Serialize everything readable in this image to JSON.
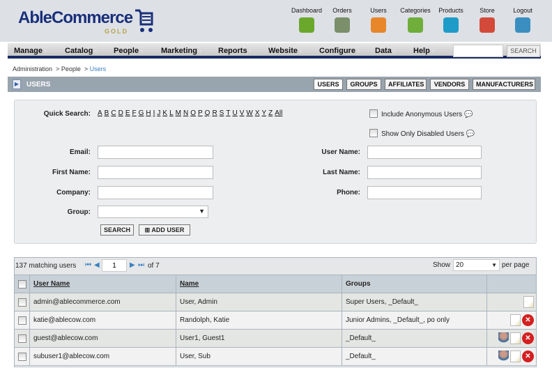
{
  "brand": {
    "name": "AbleCommerce",
    "edition": "GOLD"
  },
  "top_nav": [
    {
      "label": "Dashboard",
      "icon": "dashboard-icon",
      "color": "#6aa82c"
    },
    {
      "label": "Orders",
      "icon": "orders-icon",
      "color": "#7a8f6a"
    },
    {
      "label": "Users",
      "icon": "users-icon",
      "color": "#e8862a"
    },
    {
      "label": "Categories",
      "icon": "categories-icon",
      "color": "#6fae3a"
    },
    {
      "label": "Products",
      "icon": "products-icon",
      "color": "#1f9bc8"
    },
    {
      "label": "Store",
      "icon": "store-icon",
      "color": "#d44a3a"
    },
    {
      "label": "Logout",
      "icon": "logout-icon",
      "color": "#3a8fc0"
    }
  ],
  "menu": [
    "Manage",
    "Catalog",
    "People",
    "Marketing",
    "Reports",
    "Website",
    "Configure",
    "Data",
    "Help"
  ],
  "menu_search": {
    "value": "",
    "button": "SEARCH"
  },
  "breadcrumb": [
    "Administration",
    ">",
    "People",
    ">",
    "Users"
  ],
  "page_title": "USERS",
  "tabs": [
    "USERS",
    "GROUPS",
    "AFFILIATES",
    "VENDORS",
    "MANUFACTURERS"
  ],
  "search": {
    "quick_search_label": "Quick Search:",
    "letters": [
      "A",
      "B",
      "C",
      "D",
      "E",
      "F",
      "G",
      "H",
      "I",
      "J",
      "K",
      "L",
      "M",
      "N",
      "O",
      "P",
      "Q",
      "R",
      "S",
      "T",
      "U",
      "V",
      "W",
      "X",
      "Y",
      "Z",
      "All"
    ],
    "include_anonymous": "Include Anonymous Users",
    "only_disabled": "Show Only Disabled Users",
    "email": "Email:",
    "first_name": "First Name:",
    "company": "Company:",
    "group": "Group:",
    "user_name": "User Name:",
    "last_name": "Last Name:",
    "phone": "Phone:",
    "search_button": "SEARCH",
    "add_user_button": "ADD USER"
  },
  "results": {
    "count": "137 matching users",
    "page": "1",
    "of": "of 7",
    "show": "Show",
    "per_page_value": "20",
    "per_page": "per page",
    "columns": [
      "User Name",
      "Name",
      "Groups"
    ],
    "rows": [
      {
        "user": "admin@ablecommerce.com",
        "name": "User, Admin",
        "groups": "Super Users, _Default_",
        "login": false,
        "delete": false
      },
      {
        "user": "katie@ablecow.com",
        "name": "Randolph, Katie",
        "groups": "Junior Admins, _Default_, po only",
        "login": false,
        "delete": true
      },
      {
        "user": "guest@ablecow.com",
        "name": "User1, Guest1",
        "groups": "_Default_",
        "login": true,
        "delete": true
      },
      {
        "user": "subuser1@ablecow.com",
        "name": "User, Sub",
        "groups": "_Default_",
        "login": true,
        "delete": true
      }
    ]
  }
}
